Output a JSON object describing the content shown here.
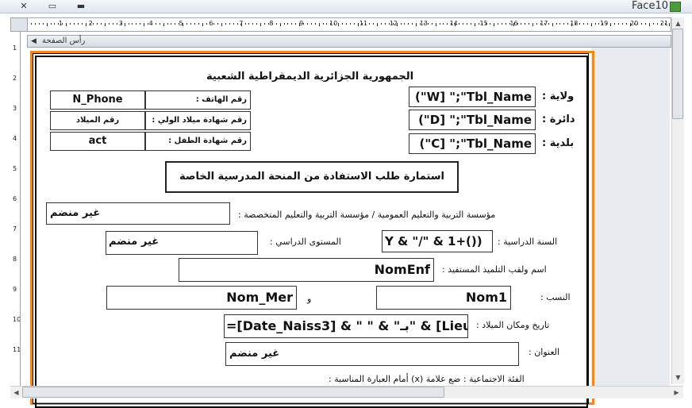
{
  "window": {
    "title": "Face10",
    "icons": [
      "close-icon",
      "restore-icon",
      "minimize-icon"
    ]
  },
  "section": {
    "label": "رأس الصفحة"
  },
  "ruler": {
    "h_numbers": [
      "1",
      "2",
      "3",
      "4",
      "5",
      "6",
      "7",
      "8",
      "9",
      "10",
      "11",
      "12",
      "13",
      "14",
      "15",
      "16",
      "17",
      "18",
      "19",
      "20",
      "21"
    ],
    "v_numbers": [
      "1",
      "2",
      "3",
      "4",
      "5",
      "6",
      "7",
      "8",
      "9",
      "10",
      "11"
    ]
  },
  "report": {
    "republic": "الجمهورية الجزائرية الديمقراطية الشعبية",
    "wilaya_label": "ولاية :",
    "wilaya_value": "W] \";\"Tbl_Name\")",
    "daira_label": "دائرة :",
    "daira_value": "D] \";\"Tbl_Name\")",
    "baladia_label": "بلدية :",
    "baladia_value": "C] \";\"Tbl_Name\")",
    "phone_label": "رقم الهاتف :",
    "phone_value": "N_Phone",
    "guardian_cert_label": "رقم شهادة ميلاد الولي :",
    "guardian_cert_value": "رقم الميلاد",
    "child_cert_label": "رقم شهادة الطفل :",
    "child_cert_value": "act",
    "form_title": "استمارة طلب الاستفادة من المنحة المدرسية الخاصة",
    "institution_label": "مؤسسة التربية والتعليم العمومية / مؤسسة التربية والتعليم المتخصصة :",
    "institution_value": "غير منضم",
    "school_year_label": "السنة الدراسية :",
    "school_year_value": "Y & \"/\" & 1+())",
    "level_label": "المستوى الدراسي :",
    "level_value": "غير منضم",
    "student_name_label": "اسم ولقب التلميذ المستفيد :",
    "student_name_value": "NomEnf",
    "lineage_label": "النسب :",
    "lineage_value1": "Nom1",
    "and_label": "و",
    "lineage_value2": "Nom_Mer",
    "birth_label": "تاريخ ومكان الميلاد :",
    "birth_value": "=[Date_Naiss3] & \" \" & \"بـ\" & [Lieu",
    "address_label": "العنوان :",
    "address_value": "غير منضم",
    "category_label": "الفئة الاجتماعية : ضع علامة (x) أمام العبارة المناسبة :"
  }
}
